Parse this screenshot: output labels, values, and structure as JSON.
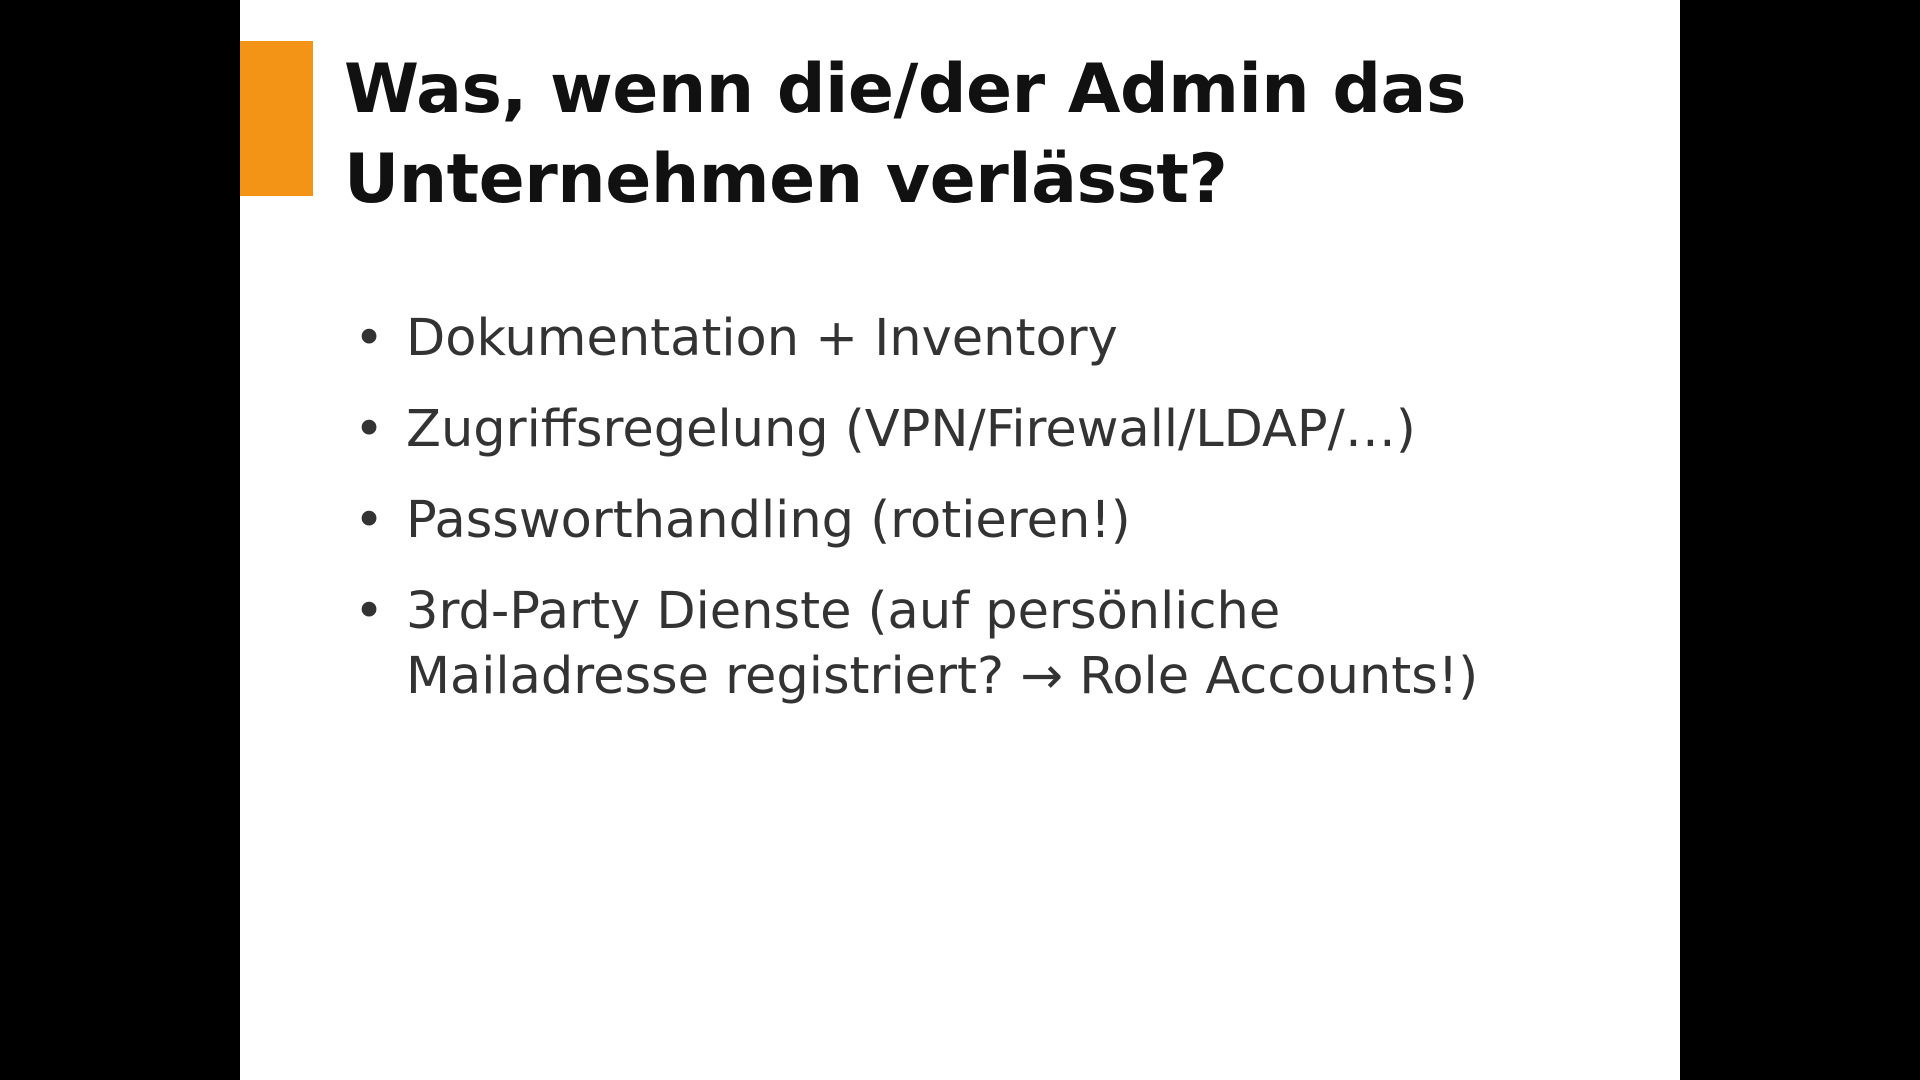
{
  "slide": {
    "accent_color": "#f39416",
    "title_lines": [
      "Was, wenn die/der Admin das",
      "Unternehmen verlässt?"
    ],
    "bullet_symbol": "•",
    "bullets": [
      {
        "lines": [
          "Dokumentation + Inventory"
        ]
      },
      {
        "lines": [
          "Zugriffsregelung (VPN/Firewall/LDAP/…)"
        ]
      },
      {
        "lines": [
          "Passworthandling (rotieren!)"
        ]
      },
      {
        "lines": [
          "3rd-Party Dienste (auf persönliche",
          "Mailadresse registriert? → Role Accounts!)"
        ]
      }
    ]
  }
}
